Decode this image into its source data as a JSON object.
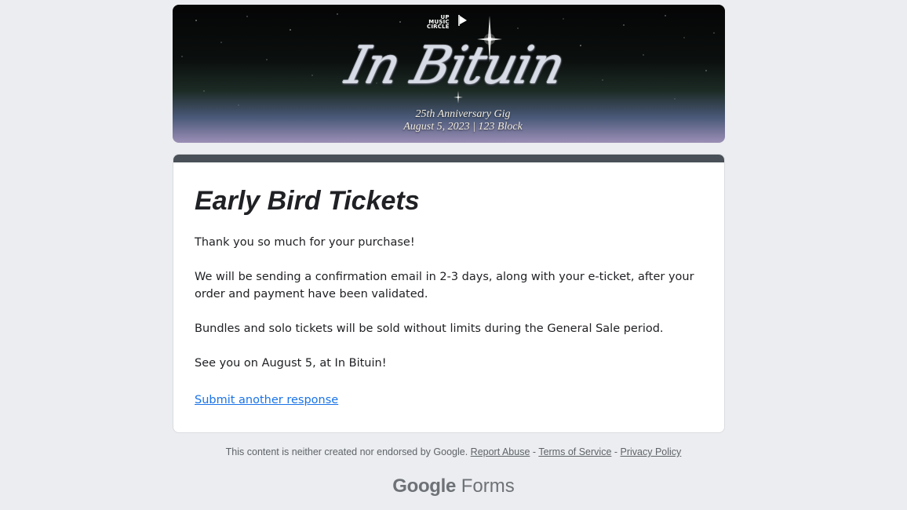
{
  "banner": {
    "logo_lines": [
      "UP",
      "MUSIC",
      "CIRCLE"
    ],
    "script_title": "In Bituin",
    "subtitle_line1": "25th Anniversary Gig",
    "subtitle_line2": "August 5, 2023  |  123 Block"
  },
  "form": {
    "accent_color": "#495057",
    "title": "Early Bird Tickets",
    "paragraphs": [
      "Thank you so much for your purchase!",
      "We will be sending a confirmation email in 2-3 days, along with your e-ticket, after your order and payment have been validated.",
      "Bundles and solo tickets will be sold without limits during the General Sale period.",
      "See you on August 5, at In Bituin!"
    ],
    "submit_another_label": "Submit another response"
  },
  "footer": {
    "disclaimer": "This content is neither created nor endorsed by Google.",
    "report_abuse": "Report Abuse",
    "terms": "Terms of Service",
    "privacy": "Privacy Policy",
    "separator": " - "
  },
  "brand": {
    "google": "Google",
    "forms": "Forms"
  }
}
